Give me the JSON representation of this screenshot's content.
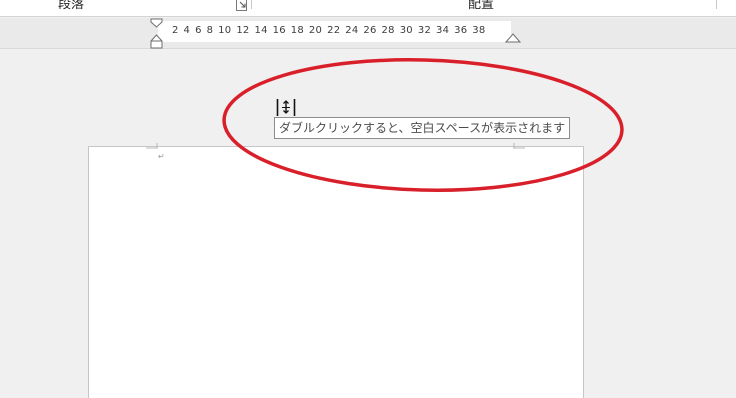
{
  "ribbon": {
    "groups": [
      {
        "label": "段落"
      },
      {
        "label": "配置"
      }
    ]
  },
  "ruler": {
    "numbers": "2 4 6 8 10 12 14 16 18 20 22 24 26 28 30 32 34 36 38"
  },
  "tooltip": {
    "text": "ダブルクリックすると、空白スペースが表示されます"
  },
  "document": {
    "paragraph_mark": "↵"
  },
  "colors": {
    "annotation": "#d9202a",
    "page": "#ffffff",
    "background": "#f0f0f0"
  },
  "icons": {
    "cursor": "hide-white-space-cursor-icon",
    "launcher": "dialog-launcher-icon"
  }
}
